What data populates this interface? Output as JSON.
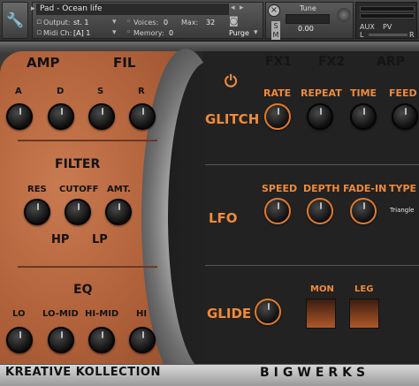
{
  "header": {
    "patch_name": "Pad - Ocean life",
    "output_label": "Output:",
    "output_value": "st. 1",
    "midi_label": "Midi Ch:",
    "midi_value": "[A] 1",
    "voices_label": "Voices:",
    "voices_value": "0",
    "max_label": "Max:",
    "max_value": "32",
    "memory_label": "Memory:",
    "memory_value": "0",
    "purge_label": "Purge",
    "tune_label": "Tune",
    "tune_value": "0.00",
    "s_label": "S",
    "m_label": "M",
    "l_label": "L",
    "r_label": "R",
    "aux_label": "AUX",
    "pv_label": "PV"
  },
  "tabs": {
    "amp": "AMP",
    "fil": "FIL",
    "fx1": "FX1",
    "fx2": "FX2",
    "arp": "ARP"
  },
  "amp": {
    "knobs": [
      "A",
      "D",
      "S",
      "R"
    ]
  },
  "filter": {
    "title": "FILTER",
    "knobs": [
      "RES",
      "CUTOFF",
      "AMT."
    ],
    "hp": "HP",
    "lp": "LP"
  },
  "eq": {
    "title": "EQ",
    "knobs": [
      "LO",
      "LO-MID",
      "HI-MID",
      "HI"
    ]
  },
  "glitch": {
    "title": "GLITCH",
    "knobs": [
      "RATE",
      "REPEAT",
      "TIME",
      "FEED"
    ]
  },
  "lfo": {
    "title": "LFO",
    "knobs": [
      "SPEED",
      "DEPTH",
      "FADE-IN",
      "TYPE"
    ],
    "type_value": "Triangle"
  },
  "glide": {
    "title": "GLIDE",
    "mon": "MON",
    "leg": "LEG"
  },
  "footer": {
    "brand_left": "KREATIVE KOLLECTION",
    "brand_right": "BIGWERKS"
  },
  "colors": {
    "accent_orange": "#f08a3a",
    "copper": "#b4643c",
    "dark_panel": "#222222"
  }
}
